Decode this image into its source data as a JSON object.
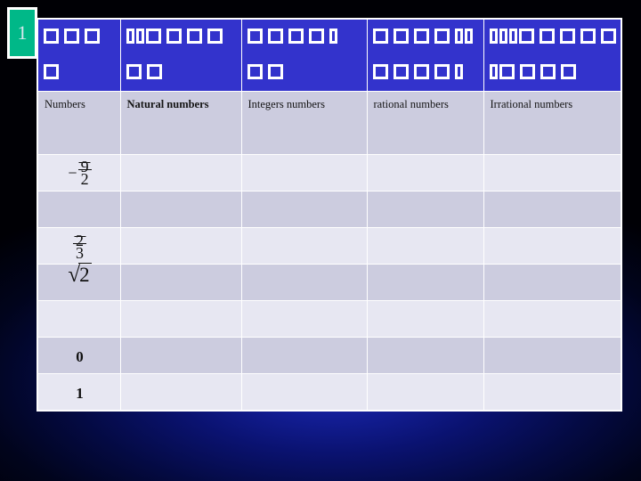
{
  "slide": {
    "number": "1",
    "badge_color": "#00b888",
    "background_color": "#000005",
    "glow_color": "#1c28b4"
  },
  "table": {
    "header_band_color": "#3333cc",
    "title_row_color": "#ccccdf",
    "row_shade_light": "#e7e7f2",
    "row_shade_dark": "#ccccdf",
    "border_color": "#ffffff",
    "header_band": {
      "note": "title text rendered as missing-glyph boxes (tofu)",
      "cells": [
        {
          "line1_boxes": 3,
          "line2_boxes": 1
        },
        {
          "line1_boxes": 6,
          "line2_boxes": 2
        },
        {
          "line1_boxes": 5,
          "line2_boxes": 2
        },
        {
          "line1_boxes": 6,
          "line2_boxes": 5
        },
        {
          "line1_boxes": 8,
          "line2_boxes": 5
        }
      ]
    },
    "column_titles": [
      {
        "label": "Numbers",
        "bold": false
      },
      {
        "label": "Natural numbers",
        "bold": true
      },
      {
        "label": "Integers numbers",
        "bold": false
      },
      {
        "label": "rational numbers",
        "bold": false
      },
      {
        "label": "Irrational numbers",
        "bold": false
      }
    ],
    "rows": [
      {
        "value_type": "fraction",
        "sign": "−",
        "numerator": "9",
        "denominator": "2",
        "display": "− 9/2"
      },
      {
        "value_type": "empty",
        "display": ""
      },
      {
        "value_type": "fraction",
        "sign": "",
        "numerator": "2",
        "denominator": "3",
        "display": "2/3"
      },
      {
        "value_type": "radical",
        "radicand": "2",
        "display": "√2"
      },
      {
        "value_type": "empty",
        "display": ""
      },
      {
        "value_type": "number",
        "display": "0"
      },
      {
        "value_type": "number",
        "display": "1"
      }
    ]
  }
}
